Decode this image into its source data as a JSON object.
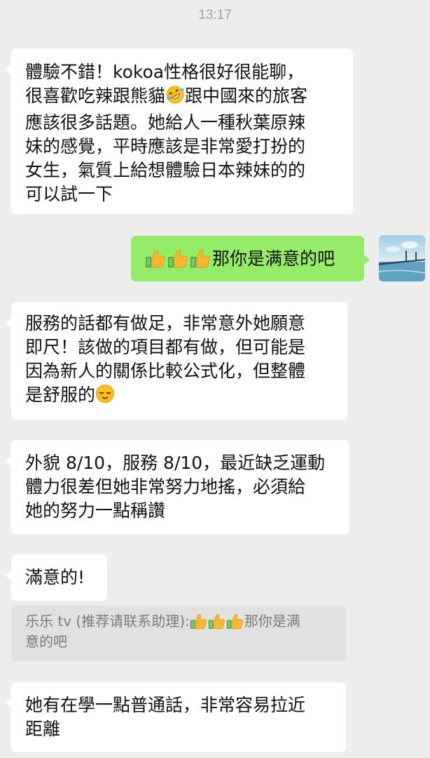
{
  "header": {
    "time": "13:17"
  },
  "messages": {
    "m1": {
      "text": "體驗不錯！kokoa性格很好很能聊，\n很喜歡吃辣跟熊貓",
      "emoji": "rofl-emoji",
      "text_after": "跟中國來的旅客\n應該很多話題。她給人一種秋葉原辣\n妹的感覺，平時應該是非常愛打扮的\n女生，氣質上給想體驗日本辣妹的的\n可以試一下"
    },
    "m2": {
      "icons": [
        "thumbs-up-icon",
        "thumbs-up-icon",
        "thumbs-up-icon"
      ],
      "text": "那你是满意的吧"
    },
    "m3": {
      "text": "服務的話都有做足，非常意外她願意\n即尺！該做的項目都有做，但可能是\n因為新人的關係比較公式化，但整體\n是舒服的",
      "emoji": "relieved-face-emoji"
    },
    "m4": {
      "text": "外貌 8/10，服務 8/10，最近缺乏運動\n體力很差但她非常努力地搖，必須給\n她的努力一點稱讚"
    },
    "m5": {
      "text": "滿意的!"
    },
    "quote": {
      "sender": "乐乐 tv (推荐请联系助理):",
      "icons": [
        "thumbs-up-icon",
        "thumbs-up-icon",
        "thumbs-up-icon"
      ],
      "text_line1": "那你是满",
      "text_line2": "意的吧"
    },
    "m6": {
      "text": "她有在學一點普通話，非常容易拉近\n距離"
    }
  },
  "colors": {
    "background": "#ededed",
    "incoming_bubble": "#ffffff",
    "outgoing_bubble": "#95ec69",
    "quote_block": "#e1e1e1",
    "timestamp_text": "#a0a0a0"
  }
}
